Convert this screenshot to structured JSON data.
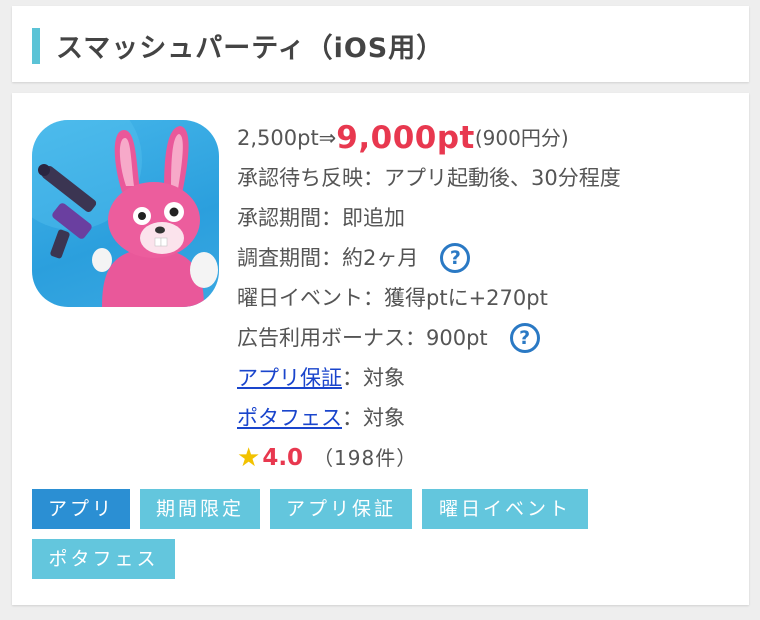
{
  "title": "スマッシュパーティ（iOS用）",
  "offer": {
    "old_price": "2,500pt⇒",
    "new_price": "9,000pt",
    "yen_note": "(900円分)"
  },
  "details": {
    "approval_reflection": "承認待ち反映：アプリ起動後、30分程度",
    "approval_period": "承認期間：即追加",
    "survey_period": "調査期間：約2ヶ月",
    "weekday_event": "曜日イベント：獲得ptに+270pt",
    "ad_bonus": "広告利用ボーナス：900pt",
    "app_guarantee_link": "アプリ保証",
    "app_guarantee_value": "：対象",
    "potafes_link": "ポタフェス",
    "potafes_value": "：対象"
  },
  "help_icon_glyph": "?",
  "rating": {
    "star_glyph": "★",
    "value": "4.0",
    "count": "（198件）"
  },
  "tags": [
    "アプリ",
    "期間限定",
    "アプリ保証",
    "曜日イベント",
    "ポタフェス"
  ],
  "colors": {
    "accent_bar": "#5bc3d6",
    "price_red": "#e8384f",
    "link_blue": "#1a45cc",
    "help_blue": "#2a79c4",
    "tag_dark": "#2b8fd3",
    "tag_light": "#63c6dd",
    "star_yellow": "#f2c200"
  },
  "icons": {
    "app_icon": "pink-bunny-with-gun-app-icon",
    "help": "question-circle-icon",
    "star": "star-icon"
  }
}
